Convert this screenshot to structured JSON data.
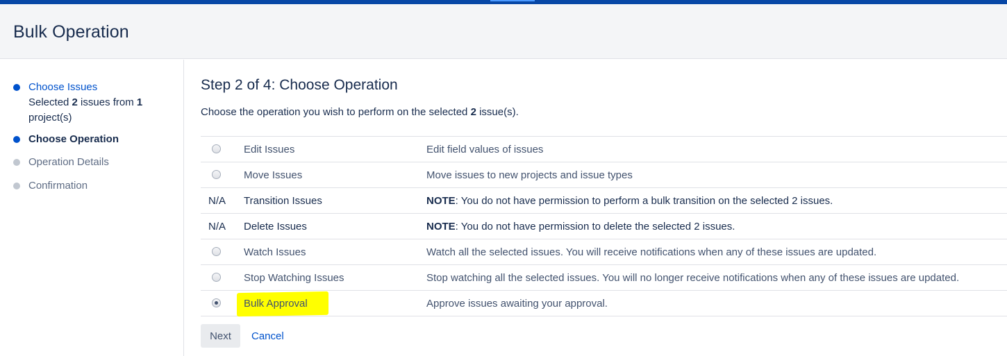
{
  "page": {
    "title": "Bulk Operation"
  },
  "sidebar": {
    "steps": [
      {
        "label": "Choose Issues",
        "state": "done",
        "detail": {
          "prefix": "Selected ",
          "count": "2",
          "middle": " issues from ",
          "projects": "1",
          "suffix": " project(s)"
        }
      },
      {
        "label": "Choose Operation",
        "state": "current"
      },
      {
        "label": "Operation Details",
        "state": "todo"
      },
      {
        "label": "Confirmation",
        "state": "todo"
      }
    ]
  },
  "main": {
    "heading": "Step 2 of 4: Choose Operation",
    "intro": {
      "prefix": "Choose the operation you wish to perform on the selected ",
      "count": "2",
      "suffix": " issue(s)."
    }
  },
  "operations": [
    {
      "name": "Edit Issues",
      "selector": "radio",
      "checked": false,
      "desc": "Edit field values of issues"
    },
    {
      "name": "Move Issues",
      "selector": "radio",
      "checked": false,
      "desc": "Move issues to new projects and issue types"
    },
    {
      "name": "Transition Issues",
      "selector": "na",
      "na_label": "N/A",
      "note_label": "NOTE",
      "desc": ": You do not have permission to perform a bulk transition on the selected 2 issues."
    },
    {
      "name": "Delete Issues",
      "selector": "na",
      "na_label": "N/A",
      "note_label": "NOTE",
      "desc": ": You do not have permission to delete the selected 2 issues."
    },
    {
      "name": "Watch Issues",
      "selector": "radio",
      "checked": false,
      "desc": "Watch all the selected issues. You will receive notifications when any of these issues are updated."
    },
    {
      "name": "Stop Watching Issues",
      "selector": "radio",
      "checked": false,
      "desc": "Stop watching all the selected issues. You will no longer receive notifications when any of these issues are updated."
    },
    {
      "name": "Bulk Approval",
      "selector": "radio",
      "checked": true,
      "highlight_color": "#ffff00",
      "desc": "Approve issues awaiting your approval."
    }
  ],
  "actions": {
    "next_label": "Next",
    "cancel_label": "Cancel"
  },
  "colors": {
    "brand_bar": "#0747a6",
    "link": "#0052cc",
    "highlight": "#ffff00"
  }
}
